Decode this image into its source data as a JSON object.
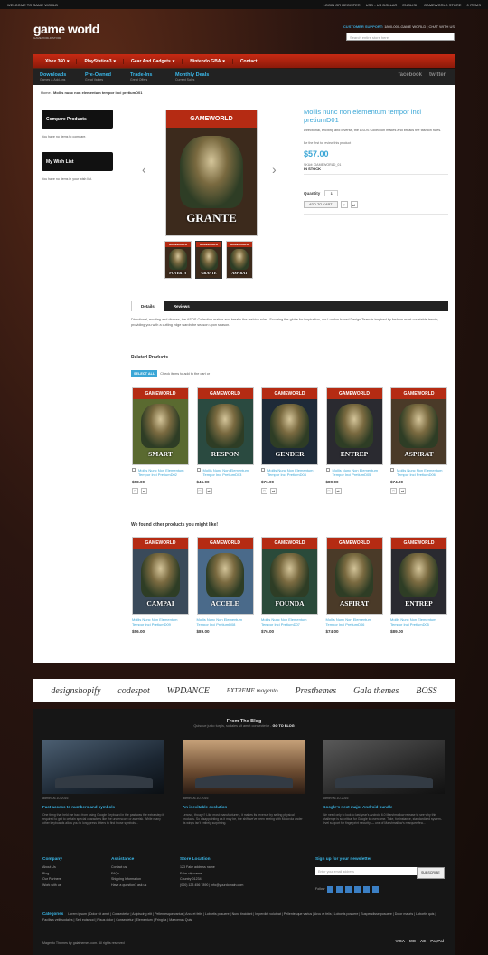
{
  "topbar": {
    "welcome": "WELCOME TO GAME WORLD",
    "login": "LOGIN OR REGISTER",
    "currency": "USD - US DOLLAR",
    "lang": "ENGLISH",
    "store": "GAMEWORLD STORE",
    "cart": "0 ITEMS"
  },
  "header": {
    "logo": "game world",
    "tagline": "GAMEWORLD STORE",
    "support_label": "CUSTOMER SUPPORT:",
    "support_text": "1800-000-GAME WORLD | CHAT WITH US",
    "search_placeholder": "Search entire store here"
  },
  "nav": [
    "Xbox 360",
    "PlayStation3",
    "Gear And Gadgets",
    "Nintendo GBA",
    "Contact"
  ],
  "subnav": [
    {
      "t": "Downloads",
      "s": "Games & Add-ons"
    },
    {
      "t": "Pre-Owned",
      "s": "Great Values"
    },
    {
      "t": "Trade-Ins",
      "s": "Great Offers"
    },
    {
      "t": "Monthly Deals",
      "s": "Current Sales"
    }
  ],
  "social": {
    "facebook": "facebook",
    "twitter": "twitter"
  },
  "breadcrumb": {
    "home": "Home",
    "sep": "/",
    "current": "Mollis nunc non elementum tempor inci pretiumD01"
  },
  "sidebar": {
    "compare_title": "Compare Products",
    "compare_text": "You have no items to compare.",
    "wish_title": "My Wish List",
    "wish_text": "You have no items in your wish list."
  },
  "product": {
    "brand": "GAMEWORLD",
    "cover_word": "GRANTE",
    "title": "Mollis nunc non elementum tempor inci pretiumD01",
    "desc": "Directional, exciting and diverse, the ASOS Collection makes and breaks the fashion rules.",
    "review": "Be the first to review this product",
    "price": "$57.00",
    "sku_label": "SKU#:",
    "sku": "GAMEWORLD_01",
    "stock": "IN STOCK",
    "qty_label": "Quantity",
    "qty": "1",
    "add_label": "ADD TO CART",
    "thumbs": [
      "POVERTY",
      "GRANTE",
      "ASPIRAT"
    ]
  },
  "tabs": {
    "details": "Details",
    "reviews": "Reviews",
    "body": "Directional, exciting and diverse, the ASOS Collection makes and breaks the fashion rules. Scouring the globe for inspiration, our London based Design Team is inspired by fashion most covetable trends; providing you with a cutting edge wardrobe season upon season."
  },
  "related": {
    "title": "Related Products",
    "select_all": "SELECT ALL",
    "hint": "Check items to add to the cart or",
    "items": [
      {
        "word": "SMART",
        "name": "Mollis Nunc Non Elementum Tempor Inci PretiumD02",
        "price": "$58.00"
      },
      {
        "word": "RESPON",
        "name": "Mollis Nunc Non Elementum Tempor Inci PretiumD03",
        "price": "$46.00"
      },
      {
        "word": "GENDER",
        "name": "Mollis Nunc Non Elementum Tempor Inci PretiumD04",
        "price": "$76.00"
      },
      {
        "word": "ENTREP",
        "name": "Mollis Nunc Non Elementum Tempor Inci PretiumD05",
        "price": "$89.00"
      },
      {
        "word": "ASPIRAT",
        "name": "Mollis Nunc Non Elementum Tempor Inci PretiumD06",
        "price": "$74.00"
      }
    ]
  },
  "upsell": {
    "title": "We found other products you might like!",
    "items": [
      {
        "word": "CAMPAI",
        "name": "Mollis Nunc Non Elementum Tempor Inci PretiumD09",
        "price": "$56.00"
      },
      {
        "word": "ACCELE",
        "name": "Mollis Nunc Non Elementum Tempor Inci PretiumD08",
        "price": "$89.00"
      },
      {
        "word": "FOUNDA",
        "name": "Mollis Nunc Non Elementum Tempor Inci PretiumD07",
        "price": "$76.00"
      },
      {
        "word": "ASPIRAT",
        "name": "Mollis Nunc Non Elementum Tempor Inci PretiumD06",
        "price": "$74.00"
      },
      {
        "word": "ENTREP",
        "name": "Mollis Nunc Non Elementum Tempor Inci PretiumD05",
        "price": "$89.00"
      }
    ]
  },
  "brands": [
    "designshopify",
    "codespot",
    "WPDANCE",
    "EXTREME magento",
    "Presthemes",
    "Gala themes",
    "BOSS"
  ],
  "blog": {
    "title": "From The Blog",
    "sub": "Quisque justo turpis, sodales sit amet consectetur -",
    "link": "GO TO BLOG",
    "posts": [
      {
        "meta": "admin   06-10-2016",
        "title": "Fast access to numbers and symbols",
        "ex": "One thing that held me back from using Google Keyboard in the past was the extra step it required to get to certain special characters like the underscore or asterisk. While many other keyboards allow you to long-press letters to find those symbols..."
      },
      {
        "meta": "admin   06-10-2016",
        "title": "An inevitable evolution",
        "ex": "Lenovo, though? Like most manufacturers, it makes its revenue by selling physical products. So disappointing as it may be, the shift we've been seeing with Motorola under its wings isn't entirely surprising."
      },
      {
        "meta": "admin   06-10-2016",
        "title": "Google's next major Android bundle",
        "ex": "We need only to look to last year's Android 6.0 Marshmallow release to see why this challenge is so critical for Google to overcome. Take, for instance, standardized system-level support for fingerprint security — one of Marshmallow's marquee fea..."
      }
    ]
  },
  "footer": {
    "company": {
      "title": "Company",
      "links": [
        "About Us",
        "Blog",
        "Our Partners",
        "Work with us"
      ]
    },
    "assistance": {
      "title": "Assistance",
      "links": [
        "Contact us",
        "FAQs",
        "Shipping Information",
        "Have a question? ask us"
      ]
    },
    "store": {
      "title": "Store Location",
      "lines": [
        "123 Fake address name",
        "Fake city name",
        "Country 01234",
        "(000) 123 456 7890 | info@yourdomain.com"
      ]
    },
    "newsletter": {
      "title": "Sign up for your newsletter",
      "placeholder": "Enter your email address",
      "button": "SUBSCRIBE",
      "follow": "Follow"
    },
    "cats_label": "Categories",
    "cats": "Lorem ipsum  |  Dolor sit amet  |  Consectetur  |  Adipiscing elit  |  Pellentesque varius  |  Arcu et felis  |  Lobortis posuere  |  Nunc tincidunt  |  Imperdiet volutpat  |  Pellentesque varius  |  Arcu et felis  |  Lobortis posuere  |  Suspendisse posuere  |  Dolor mauris  |  Lobortis quis  |  Facilisis velit sodales  |  Sed euismod  |  Risus dolor  |  Consectetur  |  Elementum  |  Fringilla  |  Maecenas Quis",
    "copyright": "Magento Themes by galathemes.com. All rights reserved",
    "payments": [
      "VISA",
      "MC",
      "AE",
      "PayPal"
    ]
  }
}
